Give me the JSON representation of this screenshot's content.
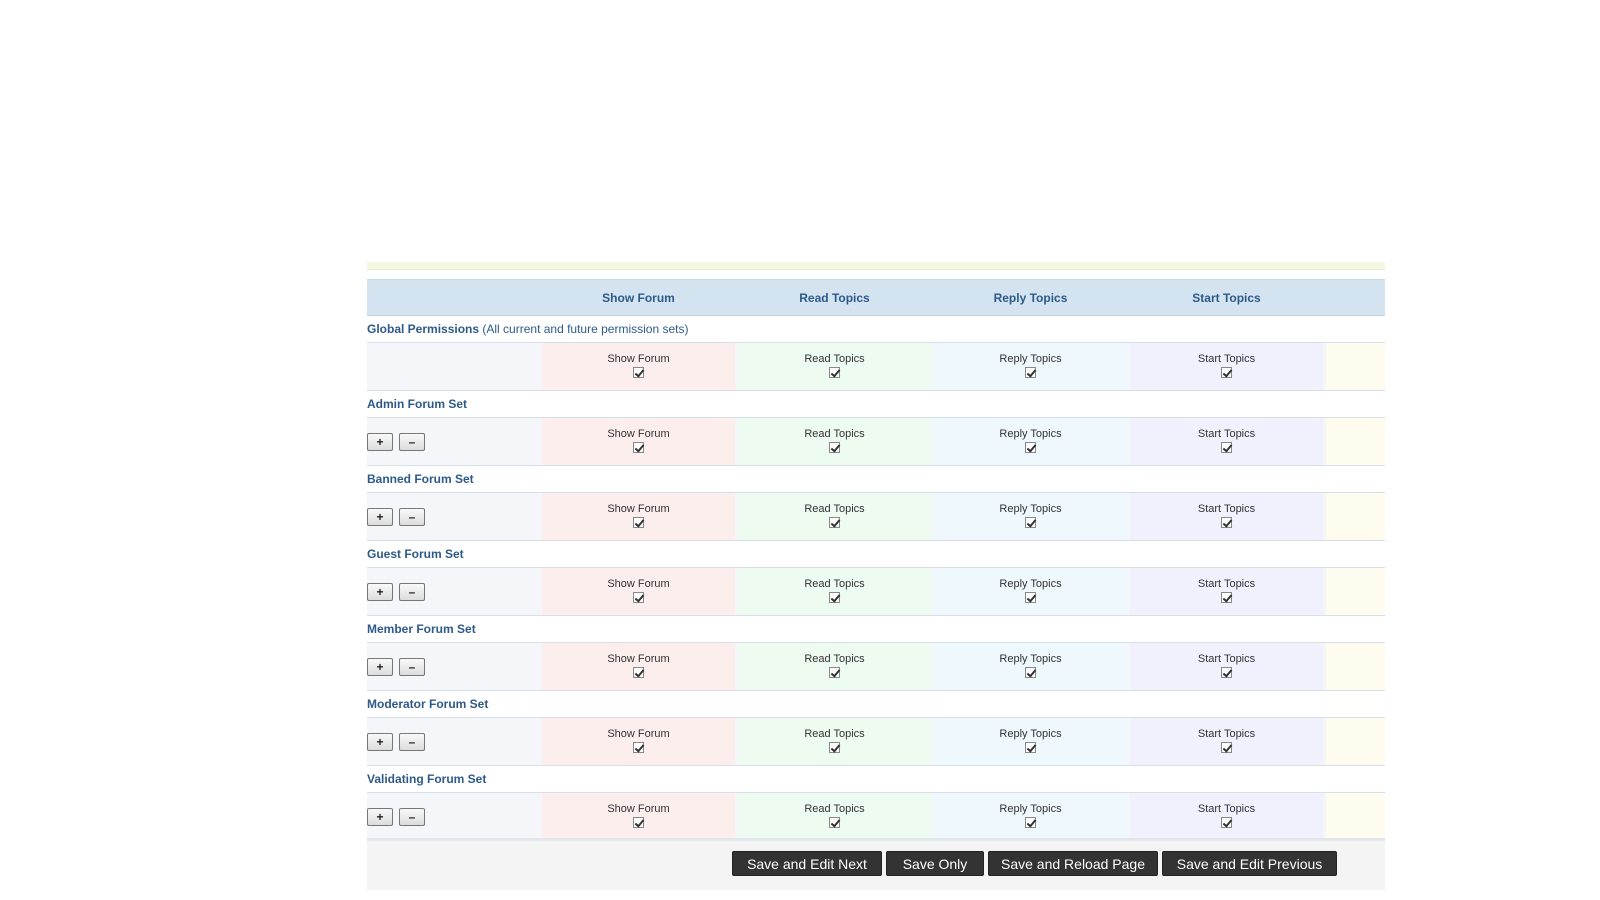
{
  "header": {
    "columns": [
      "Show Forum",
      "Read Topics",
      "Reply Topics",
      "Start Topics"
    ]
  },
  "global": {
    "title": "Global Permissions",
    "subtitle": "(All current and future permission sets)",
    "cells": [
      {
        "label": "Show Forum",
        "checked": true
      },
      {
        "label": "Read Topics",
        "checked": true
      },
      {
        "label": "Reply Topics",
        "checked": true
      },
      {
        "label": "Start Topics",
        "checked": true
      }
    ]
  },
  "sets": [
    {
      "title": "Admin Forum Set",
      "plus": "+",
      "minus": "–",
      "cells": [
        "Show Forum",
        "Read Topics",
        "Reply Topics",
        "Start Topics"
      ]
    },
    {
      "title": "Banned Forum Set",
      "plus": "+",
      "minus": "–",
      "cells": [
        "Show Forum",
        "Read Topics",
        "Reply Topics",
        "Start Topics"
      ]
    },
    {
      "title": "Guest Forum Set",
      "plus": "+",
      "minus": "–",
      "cells": [
        "Show Forum",
        "Read Topics",
        "Reply Topics",
        "Start Topics"
      ]
    },
    {
      "title": "Member Forum Set",
      "plus": "+",
      "minus": "–",
      "cells": [
        "Show Forum",
        "Read Topics",
        "Reply Topics",
        "Start Topics"
      ]
    },
    {
      "title": "Moderator Forum Set",
      "plus": "+",
      "minus": "–",
      "cells": [
        "Show Forum",
        "Read Topics",
        "Reply Topics",
        "Start Topics"
      ]
    },
    {
      "title": "Validating Forum Set",
      "plus": "+",
      "minus": "–",
      "cells": [
        "Show Forum",
        "Read Topics",
        "Reply Topics",
        "Start Topics"
      ]
    }
  ],
  "footer": {
    "save_edit_next": "Save and Edit Next",
    "save_only": "Save Only",
    "save_reload": "Save and Reload Page",
    "save_edit_previous": "Save and Edit Previous"
  }
}
